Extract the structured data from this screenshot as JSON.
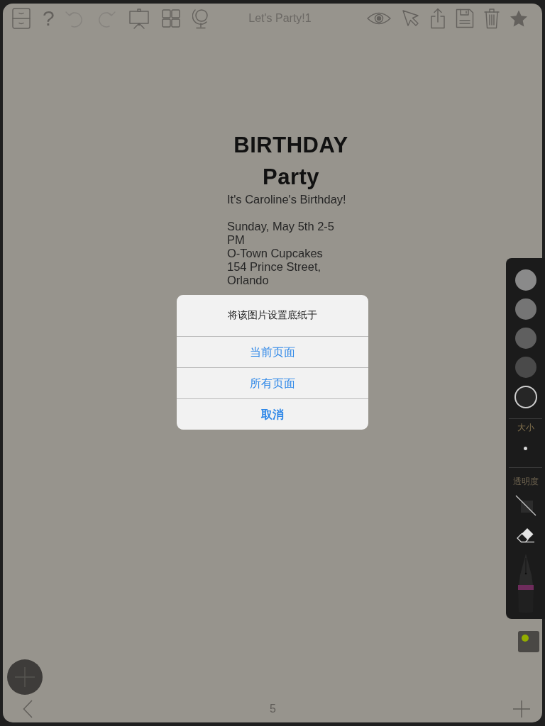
{
  "toolbar": {
    "left_tools": [
      {
        "kind": "cabinet",
        "disabled": false
      },
      {
        "kind": "help",
        "label": "?",
        "disabled": false
      },
      {
        "kind": "undo",
        "disabled": true
      },
      {
        "kind": "redo",
        "disabled": true
      },
      {
        "kind": "easel",
        "disabled": false
      },
      {
        "kind": "grid",
        "disabled": false
      },
      {
        "kind": "globe",
        "disabled": false
      }
    ],
    "title": "Let's Party!1",
    "right_tools": [
      {
        "kind": "eye"
      },
      {
        "kind": "cursor"
      },
      {
        "kind": "share"
      },
      {
        "kind": "save"
      },
      {
        "kind": "trash"
      },
      {
        "kind": "star"
      }
    ]
  },
  "document": {
    "heading_lines": [
      "BIRTHDAY",
      "Party"
    ],
    "paragraphs": [
      [
        "It's Caroline's Birthday!"
      ],
      [
        "Sunday, May 5th 2-5 PM",
        "O-Town Cupcakes",
        "154 Prince Street, Orlando"
      ]
    ]
  },
  "dialog": {
    "title": "将该图片设置底纸于",
    "actions": [
      {
        "label": "当前页面",
        "kind": "default"
      },
      {
        "label": "所有页面",
        "kind": "default"
      },
      {
        "label": "取消",
        "kind": "cancel"
      }
    ]
  },
  "brush_panel": {
    "swatches": [
      {
        "color": "#8a8a8a",
        "selected": false
      },
      {
        "color": "#757575",
        "selected": false
      },
      {
        "color": "#5f5f5f",
        "selected": false
      },
      {
        "color": "#4a4a4a",
        "selected": false
      },
      {
        "color": "#262626",
        "selected": true
      }
    ],
    "size_label": "大小",
    "opacity_label": "透明度",
    "tools": [
      {
        "kind": "no_fill"
      },
      {
        "kind": "eraser"
      },
      {
        "kind": "pen"
      }
    ]
  },
  "bottom_bar": {
    "page_number": "5"
  }
}
